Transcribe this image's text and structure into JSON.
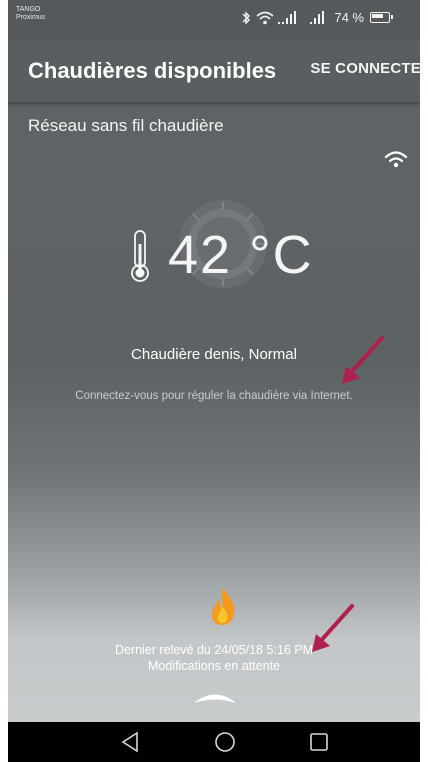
{
  "status_bar": {
    "carrier_line1": "TANGO",
    "carrier_line2": "Proximus",
    "signal_text": "..ıll ..ıl",
    "battery_percent": "74 %"
  },
  "app_bar": {
    "title": "Chaudières disponibles",
    "connect_label": "SE CONNECTER"
  },
  "network": {
    "label": "Réseau sans fil chaudière",
    "icon": "wifi-icon"
  },
  "boiler": {
    "temperature": "42 °C",
    "status": "Chaudière denis, Normal",
    "hint": "Connectez-vous pour réguler la chaudière via Internet.",
    "last_reading": "Dernier relevé du 24/05/18 5:16 PM",
    "pending": "Modifications en attente"
  },
  "icons": {
    "thermometer": "thermometer-icon",
    "flame": "flame-icon",
    "drag_handle": "chevron-up-handle-icon",
    "annotation_arrow": "red-arrow-annotation"
  },
  "colors": {
    "background_top": "#5f6466",
    "background_bottom": "#cbcecf",
    "annotation": "#b0204e",
    "flame_orange": "#f39a1e",
    "flame_yellow": "#f7c52b"
  },
  "nav": {
    "back": "back-icon",
    "home": "home-icon",
    "recents": "recents-icon"
  }
}
